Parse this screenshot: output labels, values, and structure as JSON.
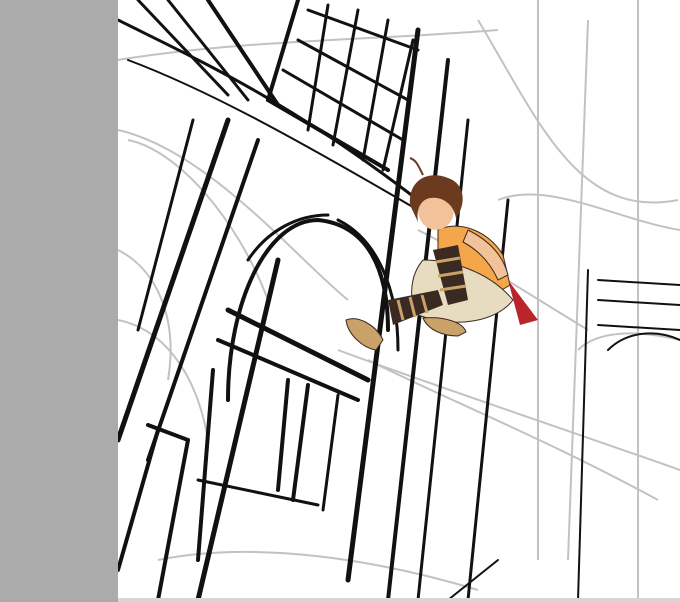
{
  "app": {
    "side_panel": {
      "color": "#ababab"
    },
    "canvas": {
      "background": "#ffffff",
      "line_color": "#111111",
      "sketch_color": "#9a9a9a"
    },
    "figure": {
      "hair_color": "#6b3a1f",
      "skin_color": "#f2c29a",
      "shirt_color": "#f4a64a",
      "pants_color": "#e7dcc0",
      "stripe_color": "#3b2a22",
      "cape_color": "#b8262b",
      "shoe_color": "#c9a26a"
    }
  }
}
